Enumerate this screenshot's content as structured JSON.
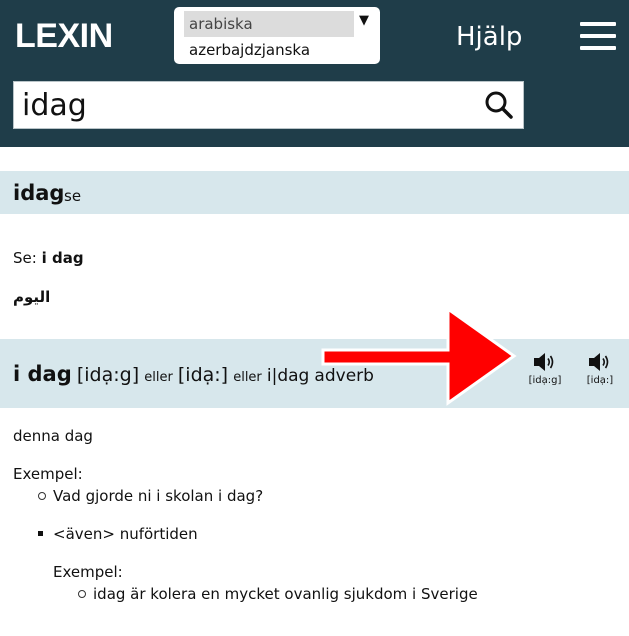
{
  "header": {
    "logo": "LEXIN",
    "language_select": {
      "selected": "arabiska",
      "next_option": "azerbajdzjanska",
      "arrow": "▼"
    },
    "help_label": "Hjälp",
    "menu_icon": "hamburger-menu-icon"
  },
  "search": {
    "value": "idag",
    "icon": "search-icon"
  },
  "entries": [
    {
      "headword": "idag",
      "tag": "se",
      "see_label": "Se:",
      "see_target": "i dag",
      "translation": "اليوم"
    },
    {
      "headword": "i dag",
      "pronunciation_1": "[idạ:g]",
      "or_1": "eller",
      "pronunciation_2": "[idạ:]",
      "or_2": "eller",
      "split_form": "i|dag",
      "part_of_speech": "adverb",
      "audio": [
        {
          "label": "[idạ:g]",
          "icon": "speaker-icon"
        },
        {
          "label": "[idạ:]",
          "icon": "speaker-icon"
        }
      ],
      "definition": "denna dag",
      "example_heading": "Exempel:",
      "examples": [
        "Vad gjorde ni i skolan i dag?"
      ],
      "sense_2": {
        "definition": "<även> nuförtiden",
        "example_heading": "Exempel:",
        "examples": [
          "idag är kolera en mycket ovanlig sjukdom i Sverige"
        ]
      }
    }
  ],
  "annotation": {
    "arrow_color": "#ff0000"
  },
  "colors": {
    "header_bg": "#1f3d49",
    "entry_head_bg": "#d7e7ec"
  }
}
